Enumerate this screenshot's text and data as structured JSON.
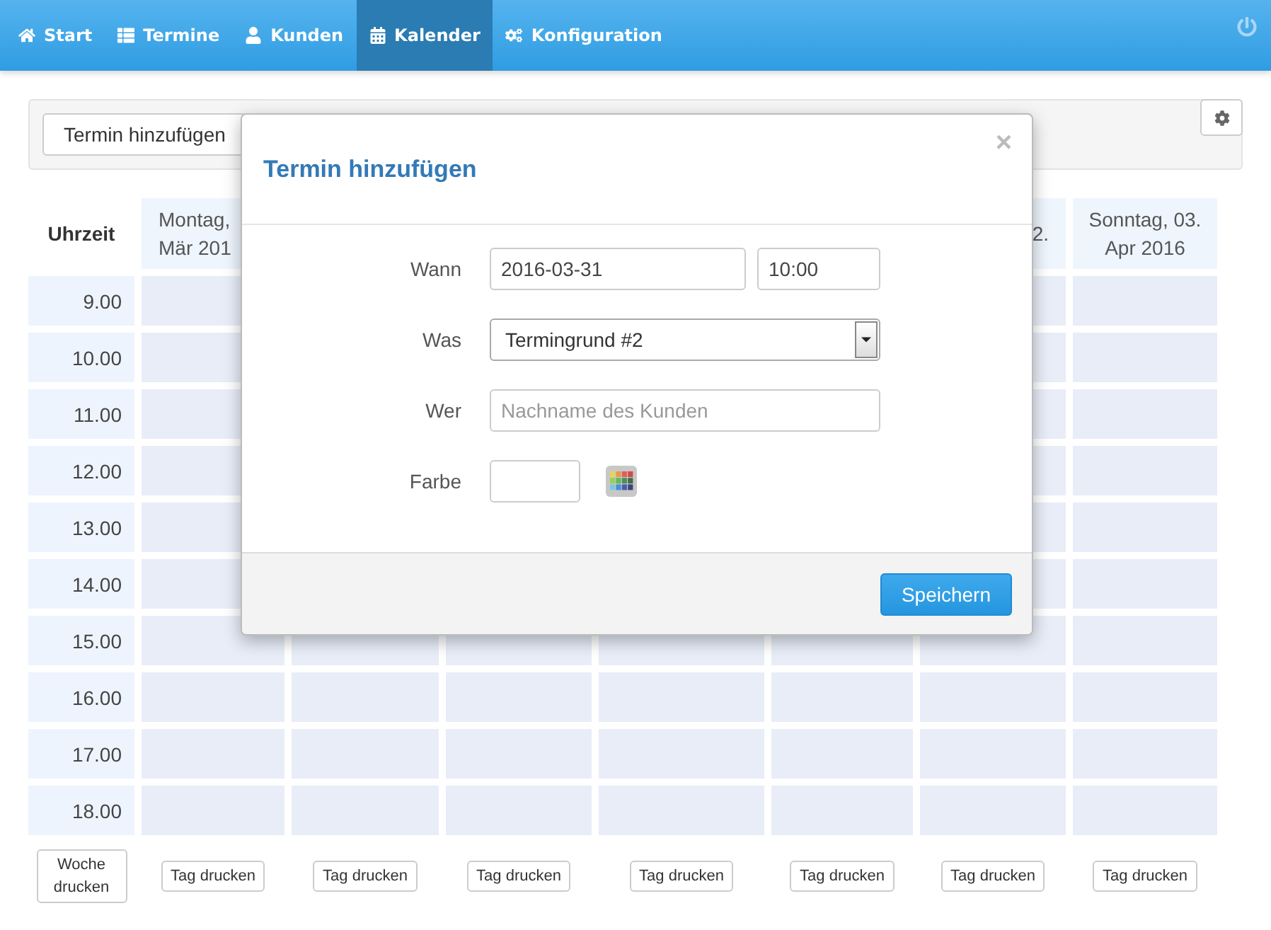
{
  "nav": {
    "items": [
      {
        "label": "Start",
        "selected": false
      },
      {
        "label": "Termine",
        "selected": false
      },
      {
        "label": "Kunden",
        "selected": false
      },
      {
        "label": "Kalender",
        "selected": true
      },
      {
        "label": "Konfiguration",
        "selected": false
      }
    ]
  },
  "toolbar": {
    "add_button": "Termin hinzufügen"
  },
  "calendar": {
    "time_header": "Uhrzeit",
    "day_headers": [
      {
        "lines": [
          "Montag,",
          "Mär 201"
        ]
      },
      {
        "lines": [
          "2."
        ]
      },
      {
        "lines": [
          "Sonntag, 03.",
          "Apr 2016"
        ]
      }
    ],
    "times": [
      "9.00",
      "10.00",
      "11.00",
      "12.00",
      "13.00",
      "14.00",
      "15.00",
      "16.00",
      "17.00",
      "18.00"
    ],
    "week_print": "Woche drucken",
    "day_print": [
      "Tag drucken",
      "Tag drucken",
      "Tag drucken",
      "Tag drucken",
      "Tag drucken",
      "Tag drucken",
      "Tag drucken"
    ]
  },
  "dialog": {
    "title": "Termin hinzufügen",
    "close": "×",
    "fields": [
      {
        "kind": "datetime",
        "label": "Wann",
        "value": "2016-03-31",
        "time": "10:00"
      },
      {
        "kind": "select",
        "label": "Was",
        "value": "Termingrund #2"
      },
      {
        "kind": "text",
        "label": "Wer",
        "placeholder": "Nachname des Kunden"
      },
      {
        "kind": "color",
        "label": "Farbe"
      }
    ],
    "save_button": "Speichern"
  }
}
